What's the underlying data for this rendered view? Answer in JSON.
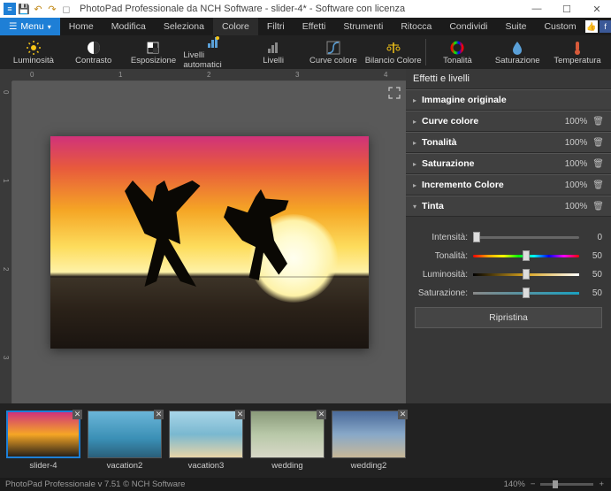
{
  "titlebar": {
    "title": "PhotoPad Professionale da NCH Software - slider-4* - Software con licenza"
  },
  "menubar": {
    "menu_btn": "Menu",
    "items": [
      "Home",
      "Modifica",
      "Seleziona",
      "Colore",
      "Filtri",
      "Effetti",
      "Strumenti",
      "Ritocca",
      "Condividi",
      "Suite",
      "Custom"
    ],
    "active_index": 3
  },
  "toolbar": {
    "items": [
      {
        "label": "Luminosità",
        "icon": "brightness"
      },
      {
        "label": "Contrasto",
        "icon": "contrast"
      },
      {
        "label": "Esposizione",
        "icon": "exposure"
      },
      {
        "label": "Livelli automatici",
        "icon": "auto-levels"
      },
      {
        "label": "Livelli",
        "icon": "levels"
      },
      {
        "label": "Curve colore",
        "icon": "curves"
      },
      {
        "label": "Bilancio Colore",
        "icon": "balance"
      },
      {
        "label": "Tonalità",
        "icon": "hue"
      },
      {
        "label": "Saturazione",
        "icon": "saturation"
      },
      {
        "label": "Temperatura",
        "icon": "temperature"
      }
    ],
    "separator_after": 6
  },
  "ruler": {
    "h": [
      "0",
      "1",
      "2",
      "3",
      "4"
    ],
    "v": [
      "0",
      "1",
      "2",
      "3"
    ]
  },
  "panel": {
    "header": "Effetti e livelli",
    "items": [
      {
        "label": "Immagine originale",
        "pct": "",
        "expanded": false,
        "deletable": false
      },
      {
        "label": "Curve colore",
        "pct": "100%",
        "expanded": false,
        "deletable": true
      },
      {
        "label": "Tonalità",
        "pct": "100%",
        "expanded": false,
        "deletable": true
      },
      {
        "label": "Saturazione",
        "pct": "100%",
        "expanded": false,
        "deletable": true
      },
      {
        "label": "Incremento Colore",
        "pct": "100%",
        "expanded": false,
        "deletable": true
      },
      {
        "label": "Tinta",
        "pct": "100%",
        "expanded": true,
        "deletable": true
      }
    ],
    "sliders": {
      "intensity": {
        "label": "Intensità:",
        "value": "0",
        "pos": 0
      },
      "hue": {
        "label": "Tonalità:",
        "value": "50",
        "pos": 50
      },
      "luminosity": {
        "label": "Luminosità:",
        "value": "50",
        "pos": 50
      },
      "saturation": {
        "label": "Saturazione:",
        "value": "50",
        "pos": 50
      }
    },
    "reset": "Ripristina"
  },
  "thumbs": [
    {
      "name": "slider-4",
      "active": true,
      "bg": "linear-gradient(to bottom,#d0327a,#f5a625 50%,#2a2118)"
    },
    {
      "name": "vacation2",
      "active": false,
      "bg": "linear-gradient(to bottom,#6bb5d8,#3a8fb5 60%,#2a5f7a)"
    },
    {
      "name": "vacation3",
      "active": false,
      "bg": "linear-gradient(to bottom,#a8d5e8,#7ab8d0 50%,#e8d5a8)"
    },
    {
      "name": "wedding",
      "active": false,
      "bg": "linear-gradient(to bottom,#8a9a7a,#b8c8a8 50%,#d8d8c8)"
    },
    {
      "name": "wedding2",
      "active": false,
      "bg": "linear-gradient(to bottom,#4a6a9a,#88a8c8 50%,#c8b898)"
    }
  ],
  "statusbar": {
    "text": "PhotoPad Professionale v 7.51 © NCH Software",
    "zoom": "140%"
  }
}
